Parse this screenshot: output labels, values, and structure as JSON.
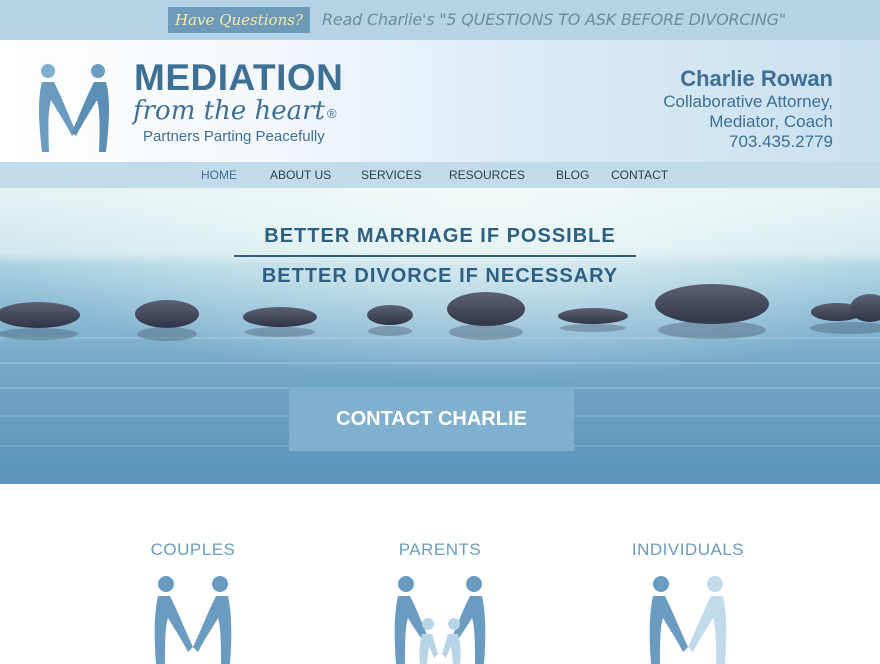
{
  "topbar": {
    "badge": "Have Questions?",
    "text": "Read Charlie's \"5 QUESTIONS TO ASK BEFORE DIVORCING\""
  },
  "logo": {
    "title": "MEDIATION",
    "script": "from the heart",
    "registered": "®",
    "tagline": "Partners Parting Peacefully"
  },
  "contact": {
    "name": "Charlie Rowan",
    "title_line1": "Collaborative Attorney,",
    "title_line2": "Mediator, Coach",
    "phone": "703.435.2779"
  },
  "nav": {
    "items": [
      {
        "label": "HOME"
      },
      {
        "label": "ABOUT US"
      },
      {
        "label": "SERVICES"
      },
      {
        "label": "RESOURCES"
      },
      {
        "label": "BLOG"
      },
      {
        "label": "CONTACT"
      }
    ],
    "active": "HOME"
  },
  "hero": {
    "line1": "BETTER MARRIAGE IF POSSIBLE",
    "line2": "BETTER DIVORCE IF NECESSARY",
    "cta": "CONTACT CHARLIE"
  },
  "audiences": [
    {
      "label": "COUPLES",
      "icon": "couple-figures-icon"
    },
    {
      "label": "PARENTS",
      "icon": "family-figures-icon"
    },
    {
      "label": "INDIVIDUALS",
      "icon": "individual-figures-icon"
    }
  ],
  "colors": {
    "brand_blue": "#3e6f95",
    "topbar_bg": "#b6d3e6",
    "badge_bg": "#6d9ab8",
    "badge_text": "#f6e9a8",
    "cta_bg": "#7fb0d0",
    "audience_label": "#6a9cc1"
  }
}
